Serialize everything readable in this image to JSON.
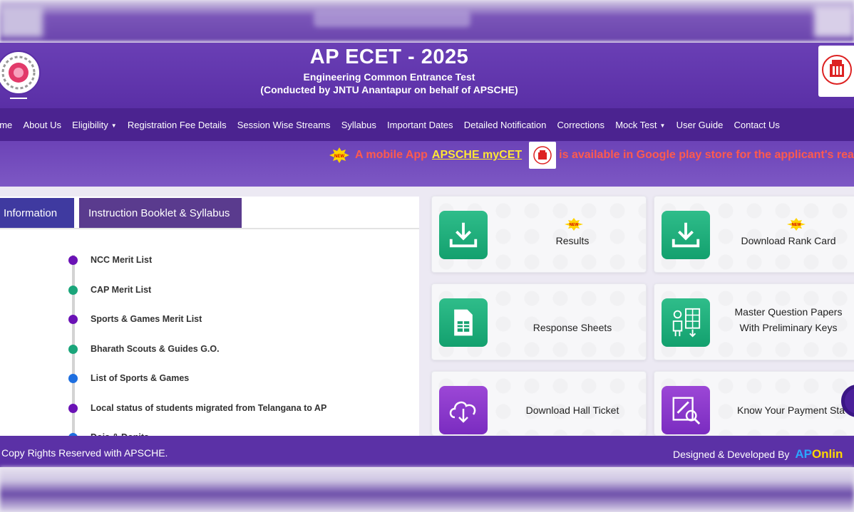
{
  "header": {
    "title": "AP ECET - 2025",
    "subtitle": "Engineering Common Entrance Test",
    "subtitle2": "(Conducted by JNTU Anantapur on behalf of APSCHE)"
  },
  "nav": {
    "items": [
      {
        "label": "ome",
        "dropdown": false
      },
      {
        "label": "About Us",
        "dropdown": false
      },
      {
        "label": "Eligibility",
        "dropdown": true
      },
      {
        "label": "Registration Fee Details",
        "dropdown": false
      },
      {
        "label": "Session Wise Streams",
        "dropdown": false
      },
      {
        "label": "Syllabus",
        "dropdown": false
      },
      {
        "label": "Important Dates",
        "dropdown": false
      },
      {
        "label": "Detailed Notification",
        "dropdown": false
      },
      {
        "label": "Corrections",
        "dropdown": false
      },
      {
        "label": "Mock Test",
        "dropdown": true
      },
      {
        "label": "User Guide",
        "dropdown": false
      },
      {
        "label": "Contact Us",
        "dropdown": false
      }
    ]
  },
  "marquee": {
    "badge": "NEW",
    "text_before": "A mobile App",
    "link": "APSCHE myCET",
    "text_after": "is available in Google play store for the applicant's ready"
  },
  "tabs": {
    "info": "Information",
    "booklet": "Instruction Booklet & Syllabus"
  },
  "timeline": [
    {
      "label": "NCC Merit List",
      "color": "#6a12b5"
    },
    {
      "label": "CAP Merit List",
      "color": "#1aa57a"
    },
    {
      "label": "Sports & Games Merit List",
      "color": "#6a12b5"
    },
    {
      "label": "Bharath Scouts & Guides G.O.",
      "color": "#1aa57a"
    },
    {
      "label": "List of Sports & Games",
      "color": "#1e6fe0"
    },
    {
      "label": "Local status of students migrated from Telangana to AP",
      "color": "#6a12b5"
    },
    {
      "label": "Dois & Donits",
      "color": "#1e6fe0"
    }
  ],
  "cards": {
    "results": {
      "label": "Results",
      "badge": "NEW"
    },
    "rank_card": {
      "label": "Download Rank Card",
      "badge": "NEW"
    },
    "response_sheets": {
      "label": "Response Sheets"
    },
    "master_papers": {
      "line1": "Master Question Papers",
      "line2": "With Preliminary Keys"
    },
    "hall_ticket": {
      "label": "Download Hall Ticket"
    },
    "payment_status": {
      "label": "Know Your Payment Sta"
    }
  },
  "footer": {
    "left": "Copy Rights Reserved with APSCHE.",
    "right": "Designed & Developed By",
    "brand_a": "AP",
    "brand_b": "Onlin"
  },
  "colors": {
    "header_purple": "#5a2fa6",
    "nav_purple": "#4b2390",
    "card_green": "#13a06e",
    "card_purple": "#7a2cc0",
    "marquee_red": "#ff5a4d",
    "marquee_yellow": "#ffe733"
  }
}
